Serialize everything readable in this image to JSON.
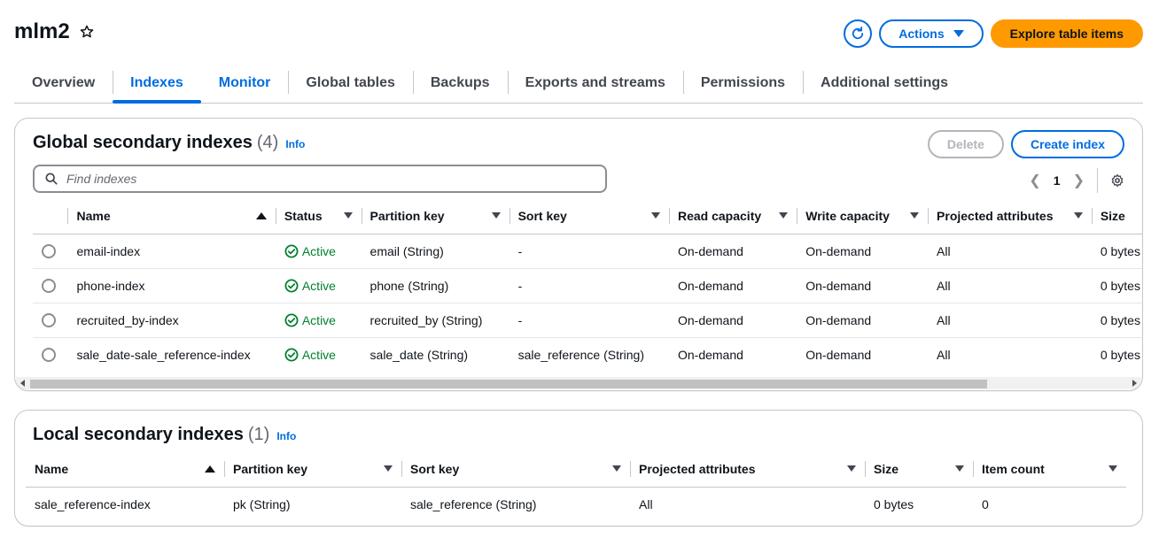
{
  "page": {
    "title": "mlm2",
    "refresh_icon": "refresh-icon",
    "actions_label": "Actions",
    "explore_label": "Explore table items"
  },
  "tabs": [
    {
      "label": "Overview"
    },
    {
      "label": "Indexes"
    },
    {
      "label": "Monitor"
    },
    {
      "label": "Global tables"
    },
    {
      "label": "Backups"
    },
    {
      "label": "Exports and streams"
    },
    {
      "label": "Permissions"
    },
    {
      "label": "Additional settings"
    }
  ],
  "gsi": {
    "title": "Global secondary indexes",
    "count": "(4)",
    "info": "Info",
    "delete_label": "Delete",
    "create_label": "Create index",
    "search_placeholder": "Find indexes",
    "page": "1",
    "headers": [
      "Name",
      "Status",
      "Partition key",
      "Sort key",
      "Read capacity",
      "Write capacity",
      "Projected attributes",
      "Size"
    ],
    "rows": [
      {
        "name": "email-index",
        "status": "Active",
        "partition": "email (String)",
        "sort": "-",
        "read": "On-demand",
        "write": "On-demand",
        "projected": "All",
        "size": "0 bytes"
      },
      {
        "name": "phone-index",
        "status": "Active",
        "partition": "phone (String)",
        "sort": "-",
        "read": "On-demand",
        "write": "On-demand",
        "projected": "All",
        "size": "0 bytes"
      },
      {
        "name": "recruited_by-index",
        "status": "Active",
        "partition": "recruited_by (String)",
        "sort": "-",
        "read": "On-demand",
        "write": "On-demand",
        "projected": "All",
        "size": "0 bytes"
      },
      {
        "name": "sale_date-sale_reference-index",
        "status": "Active",
        "partition": "sale_date (String)",
        "sort": "sale_reference (String)",
        "read": "On-demand",
        "write": "On-demand",
        "projected": "All",
        "size": "0 bytes"
      }
    ]
  },
  "lsi": {
    "title": "Local secondary indexes",
    "count": "(1)",
    "info": "Info",
    "headers": [
      "Name",
      "Partition key",
      "Sort key",
      "Projected attributes",
      "Size",
      "Item count"
    ],
    "rows": [
      {
        "name": "sale_reference-index",
        "partition": "pk (String)",
        "sort": "sale_reference (String)",
        "projected": "All",
        "size": "0 bytes",
        "count": "0"
      }
    ]
  },
  "colors": {
    "accent": "#006ce0",
    "primary": "#ff9900",
    "success": "#00802f"
  }
}
